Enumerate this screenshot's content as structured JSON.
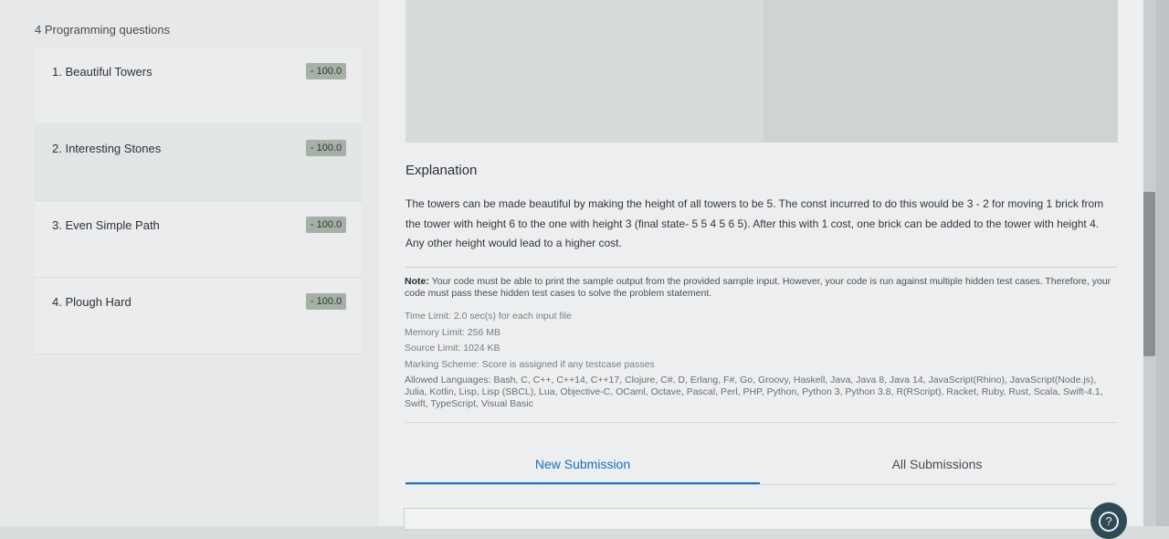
{
  "sidebar": {
    "heading": "4 Programming questions",
    "questions": [
      {
        "title": "1. Beautiful Towers",
        "score": "- 100.0"
      },
      {
        "title": "2. Interesting Stones",
        "score": "- 100.0"
      },
      {
        "title": "3. Even Simple Path",
        "score": "- 100.0"
      },
      {
        "title": "4. Plough Hard",
        "score": "- 100.0"
      }
    ]
  },
  "problem": {
    "explanation_title": "Explanation",
    "explanation_text": "The towers can be made beautiful by making the height of all towers to be 5. The const incurred to do this would be 3 - 2 for moving 1 brick from the tower with height 6 to the one with height 3 (final state- 5 5 4 5 6 5). After this with 1 cost, one brick can be added to the tower with height 4. Any other height would lead to a higher cost.",
    "note_label": "Note:",
    "note_text": "Your code must be able to print the sample output from the provided sample input. However, your code is run against multiple hidden test cases. Therefore, your code must pass these hidden test cases to solve the problem statement.",
    "time_limit": "Time Limit: 2.0 sec(s) for each input file",
    "memory_limit": "Memory Limit: 256 MB",
    "source_limit": "Source Limit: 1024 KB",
    "marking_scheme": "Marking Scheme: Score is assigned if any testcase passes",
    "allowed_languages": "Allowed Languages: Bash, C, C++, C++14, C++17, Clojure, C#, D, Erlang, F#, Go, Groovy, Haskell, Java, Java 8, Java 14, JavaScript(Rhino), JavaScript(Node.js), Julia, Kotlin, Lisp, Lisp (SBCL), Lua, Objective-C, OCaml, Octave, Pascal, Perl, PHP, Python, Python 3, Python 3.8, R(RScript), Racket, Ruby, Rust, Scala, Swift-4.1, Swift, TypeScript, Visual Basic"
  },
  "tabs": {
    "new_submission": "New Submission",
    "all_submissions": "All Submissions"
  },
  "help": {
    "icon": "question-icon",
    "glyph": "?"
  },
  "colors": {
    "accent": "#1d6fb8",
    "badge": "#a5b1a6"
  }
}
